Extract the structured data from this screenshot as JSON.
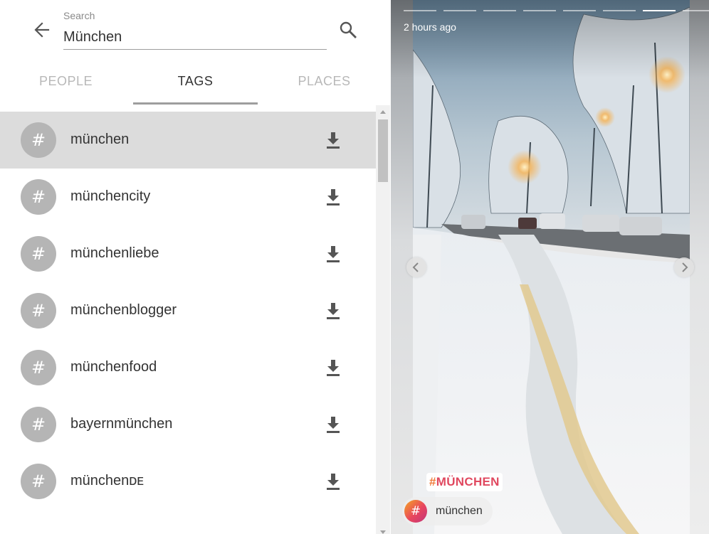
{
  "search": {
    "label": "Search",
    "value": "München"
  },
  "tabs": [
    {
      "label": "PEOPLE",
      "active": false
    },
    {
      "label": "TAGS",
      "active": true
    },
    {
      "label": "PLACES",
      "active": false
    }
  ],
  "results": [
    {
      "name": "münchen",
      "icon": "hash-icon",
      "action_icon": "download-icon",
      "selected": true
    },
    {
      "name": "münchencity",
      "icon": "hash-icon",
      "action_icon": "download-icon",
      "selected": false
    },
    {
      "name": "münchenliebe",
      "icon": "hash-icon",
      "action_icon": "download-icon",
      "selected": false
    },
    {
      "name": "münchenblogger",
      "icon": "hash-icon",
      "action_icon": "download-icon",
      "selected": false
    },
    {
      "name": "münchenfood",
      "icon": "hash-icon",
      "action_icon": "download-icon",
      "selected": false
    },
    {
      "name": "bayernmünchen",
      "icon": "hash-icon",
      "action_icon": "download-icon",
      "selected": false
    },
    {
      "name": "münchenᴅᴇ",
      "icon": "hash-icon",
      "action_icon": "download-icon",
      "selected": false
    }
  ],
  "result_icon_glyph": "#",
  "story": {
    "time": "2 hours ago",
    "progress_segments": 8,
    "active_segment": 7,
    "sticker": {
      "hash": "#",
      "text": "MÜNCHEN"
    },
    "tag_pill": {
      "icon_glyph": "#",
      "label": "münchen"
    }
  },
  "colors": {
    "selected_row": "#dcdcdc",
    "hash_circle": "#b5b5b5",
    "tab_indicator": "#9e9e9e",
    "sticker_text": "#e0485f",
    "sticker_hash": "#f07a3a"
  }
}
